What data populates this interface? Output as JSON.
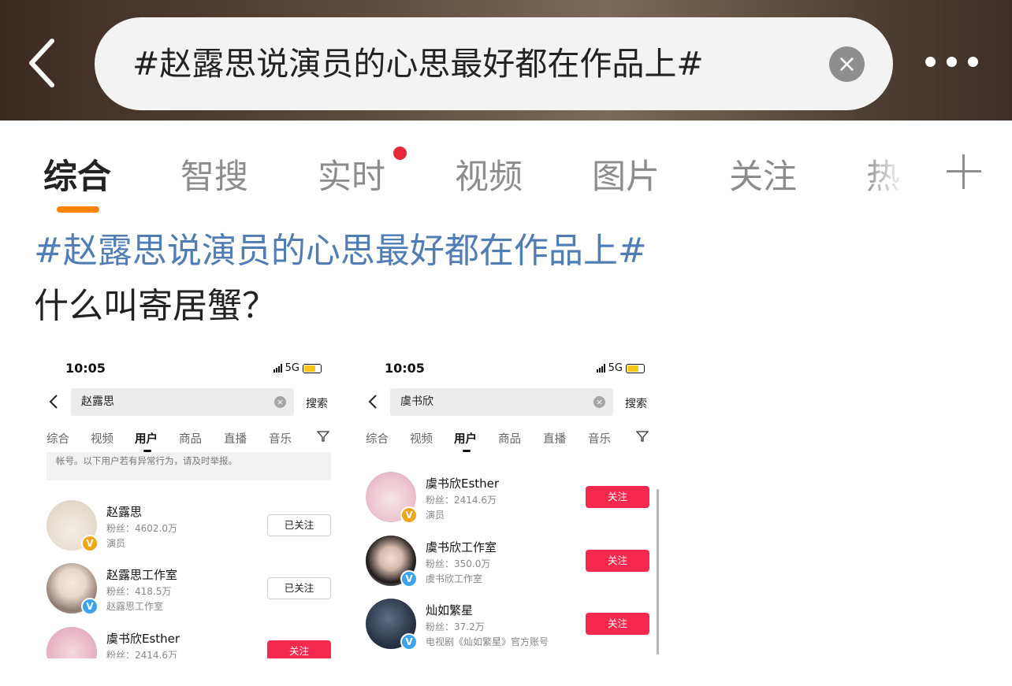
{
  "header": {
    "search_query": "#赵露思说演员的心思最好都在作品上#",
    "clear_icon": "×"
  },
  "tabs": [
    {
      "label": "综合",
      "active": true
    },
    {
      "label": "智搜"
    },
    {
      "label": "实时",
      "has_dot": true
    },
    {
      "label": "视频"
    },
    {
      "label": "图片"
    },
    {
      "label": "关注"
    },
    {
      "label": "热"
    }
  ],
  "post": {
    "hashtag": "#赵露思说演员的心思最好都在作品上#",
    "text": "什么叫寄居蟹？"
  },
  "screenshots": [
    {
      "time": "10:05",
      "network": "5G",
      "query": "赵露思",
      "search_btn": "搜索",
      "tabs": [
        "综合",
        "视频",
        "用户",
        "商品",
        "直播",
        "音乐"
      ],
      "active_tab": "用户",
      "notice": "帐号。以下用户若有异常行为，请及时举报。",
      "users": [
        {
          "name": "赵露思",
          "fans": "粉丝：4602.0万",
          "desc": "演员",
          "button": "已关注",
          "verified": "gold"
        },
        {
          "name": "赵露思工作室",
          "fans": "粉丝：418.5万",
          "desc": "赵露思工作室",
          "button": "已关注",
          "verified": "blue"
        },
        {
          "name": "虞书欣Esther",
          "fans": "粉丝：2414.6万",
          "desc": "",
          "button": "关注",
          "verified": "gold"
        }
      ]
    },
    {
      "time": "10:05",
      "network": "5G",
      "query": "虞书欣",
      "search_btn": "搜索",
      "tabs": [
        "综合",
        "视频",
        "用户",
        "商品",
        "直播",
        "音乐"
      ],
      "active_tab": "用户",
      "users": [
        {
          "name": "虞书欣Esther",
          "fans": "粉丝：2414.6万",
          "desc": "演员",
          "button": "关注",
          "verified": "gold"
        },
        {
          "name": "虞书欣工作室",
          "fans": "粉丝：350.0万",
          "desc": "虞书欣工作室",
          "button": "关注",
          "verified": "blue"
        },
        {
          "name": "灿如繁星",
          "fans": "粉丝：37.2万",
          "desc": "电视剧《灿如繁星》官方账号",
          "button": "关注",
          "verified": "blue"
        }
      ]
    }
  ],
  "colors": {
    "accent": "#ff8200",
    "hashtag": "#4f7db4",
    "follow": "#f5294e",
    "dot": "#e8283a"
  }
}
